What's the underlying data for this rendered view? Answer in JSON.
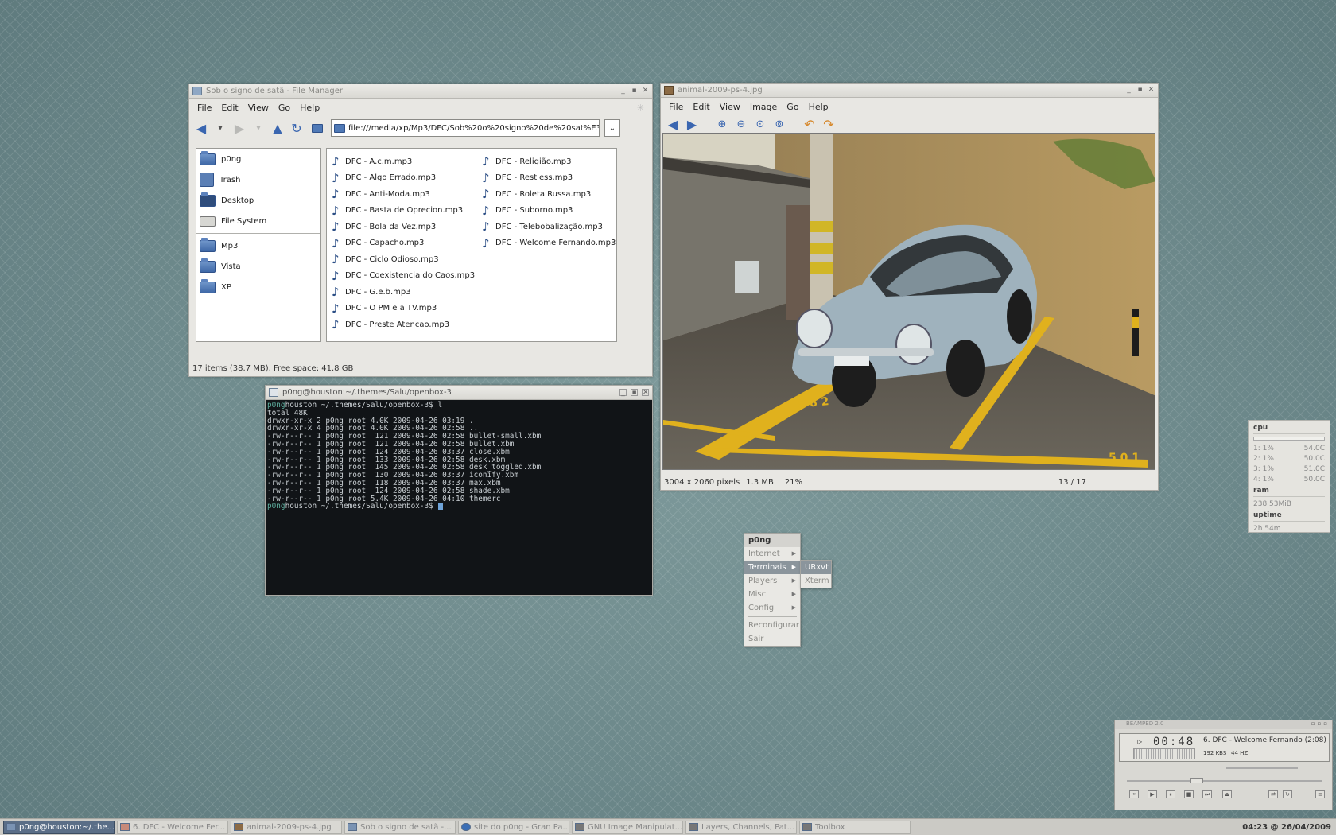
{
  "file_manager": {
    "title": "Sob o signo de satã - File Manager",
    "menu": [
      "File",
      "Edit",
      "View",
      "Go",
      "Help"
    ],
    "location": "file:///media/xp/Mp3/DFC/Sob%20o%20signo%20de%20sat%E3",
    "places": [
      "p0ng",
      "Trash",
      "Desktop",
      "File System"
    ],
    "bookmarks": [
      "Mp3",
      "Vista",
      "XP"
    ],
    "files_col1": [
      "DFC - A.c.m.mp3",
      "DFC - Algo Errado.mp3",
      "DFC - Anti-Moda.mp3",
      "DFC - Basta de Oprecion.mp3",
      "DFC - Bola da Vez.mp3",
      "DFC - Capacho.mp3",
      "DFC - Ciclo Odioso.mp3",
      "DFC - Coexistencia do Caos.mp3",
      "DFC - G.e.b.mp3",
      "DFC - O PM e a TV.mp3",
      "DFC - Preste Atencao.mp3"
    ],
    "files_col2": [
      "DFC - Religião.mp3",
      "DFC - Restless.mp3",
      "DFC - Roleta Russa.mp3",
      "DFC - Suborno.mp3",
      "DFC - Telebobalização.mp3",
      "DFC - Welcome Fernando.mp3"
    ],
    "status": "17 items (38.7 MB), Free space: 41.8 GB"
  },
  "terminal": {
    "title": "p0ng@houston:~/.themes/Salu/openbox-3",
    "prompt_user": "p0ng",
    "prompt_host": "houston ~/.themes/Salu/openbox-3",
    "command": "$ l",
    "lines": [
      "total 48K",
      "drwxr-xr-x 2 p0ng root 4.0K 2009-04-26 03:19 .",
      "drwxr-xr-x 4 p0ng root 4.0K 2009-04-26 02:58 ..",
      "-rw-r--r-- 1 p0ng root  121 2009-04-26 02:58 bullet-small.xbm",
      "-rw-r--r-- 1 p0ng root  121 2009-04-26 02:58 bullet.xbm",
      "-rw-r--r-- 1 p0ng root  124 2009-04-26 03:37 close.xbm",
      "-rw-r--r-- 1 p0ng root  133 2009-04-26 02:58 desk.xbm",
      "-rw-r--r-- 1 p0ng root  145 2009-04-26 02:58 desk_toggled.xbm",
      "-rw-r--r-- 1 p0ng root  130 2009-04-26 03:37 iconify.xbm",
      "-rw-r--r-- 1 p0ng root  118 2009-04-26 03:37 max.xbm",
      "-rw-r--r-- 1 p0ng root  124 2009-04-26 02:58 shade.xbm",
      "-rw-r--r-- 1 p0ng root 5.4K 2009-04-26 04:10 themerc"
    ],
    "end_prompt": "$ "
  },
  "image_viewer": {
    "title": "animal-2009-ps-4.jpg",
    "menu": [
      "File",
      "Edit",
      "View",
      "Image",
      "Go",
      "Help"
    ],
    "dimensions": "3004 x 2060 pixels",
    "size": "1.3 MB",
    "zoom": "21%",
    "position": "13 / 17"
  },
  "root_menu": {
    "header": "p0ng",
    "items": [
      "Internet",
      "Terminais",
      "Players",
      "Misc",
      "Config"
    ],
    "actions": [
      "Reconfigurar",
      "Sair"
    ],
    "submenu": [
      "URxvt",
      "Xterm"
    ]
  },
  "conky": {
    "cpu_label": "cpu",
    "cpu_rows": [
      {
        "core": "1: 1%",
        "temp": "54.0C"
      },
      {
        "core": "2: 1%",
        "temp": "50.0C"
      },
      {
        "core": "3: 1%",
        "temp": "51.0C"
      },
      {
        "core": "4: 1%",
        "temp": "50.0C"
      }
    ],
    "ram_label": "ram",
    "ram_value": "238.53MiB",
    "uptime_label": "uptime",
    "uptime_value": "2h 54m"
  },
  "player": {
    "title": "BEAMPED 2.0",
    "time": "00:48",
    "track": "6. DFC - Welcome Fernando (2:08)",
    "bitrate": "192 KBS",
    "samplerate": "44 HZ"
  },
  "taskbar": {
    "tasks": [
      "p0ng@houston:~/.the...",
      "6. DFC - Welcome Fer...",
      "animal-2009-ps-4.jpg",
      "Sob o signo de satã -...",
      "site do p0ng - Gran Pa...",
      "GNU Image Manipulat...",
      "Layers, Channels, Pat...",
      "Toolbox"
    ],
    "clock": "04:23 @ 26/04/2009"
  }
}
